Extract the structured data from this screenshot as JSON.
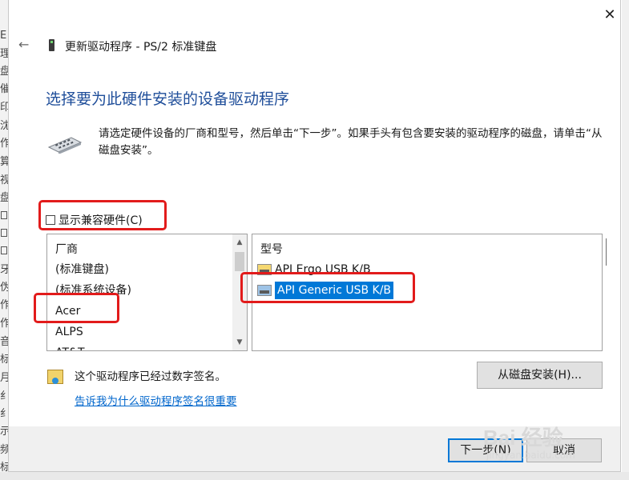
{
  "window": {
    "title": "更新驱动程序 - PS/2 标准键盘",
    "close_glyph": "✕",
    "back_glyph": "←"
  },
  "heading": "选择要为此硬件安装的设备驱动程序",
  "instructions": "请选定硬件设备的厂商和型号，然后单击“下一步”。如果手头有包含要安装的驱动程序的磁盘，请单击“从磁盘安装”。",
  "compat_checkbox": {
    "label": "显示兼容硬件(C)",
    "checked": false
  },
  "manufacturer": {
    "header": "厂商",
    "items": [
      "(标准键盘)",
      "(标准系统设备)",
      "Acer",
      "ALPS",
      "AT&T"
    ]
  },
  "model": {
    "header": "型号",
    "items": [
      {
        "label": "API Ergo USB K/B",
        "selected": false
      },
      {
        "label": "API Generic USB K/B",
        "selected": true
      }
    ]
  },
  "signature": {
    "status": "这个驱动程序已经过数字签名。",
    "link": "告诉我为什么驱动程序签名很重要"
  },
  "buttons": {
    "have_disk": "从磁盘安装(H)...",
    "next": "下一步(N)",
    "cancel": "取消"
  },
  "scrollbar": {
    "up_glyph": "▲",
    "down_glyph": "▼"
  },
  "background_glyphs": [
    "E",
    "理",
    "盘",
    "催",
    "印",
    "沈",
    "作",
    "算",
    "视",
    "盘",
    "牙",
    "伪",
    "作",
    "作",
    "音",
    "标",
    "月",
    "纟",
    "纟",
    "示",
    "频",
    "标"
  ],
  "watermark": {
    "brand": "Bai 经验",
    "url": "jingyan.baidu.com"
  },
  "colors": {
    "accent": "#0078d7",
    "heading": "#1f4e9a",
    "annotation": "#e21b1b",
    "link": "#0066cc"
  }
}
